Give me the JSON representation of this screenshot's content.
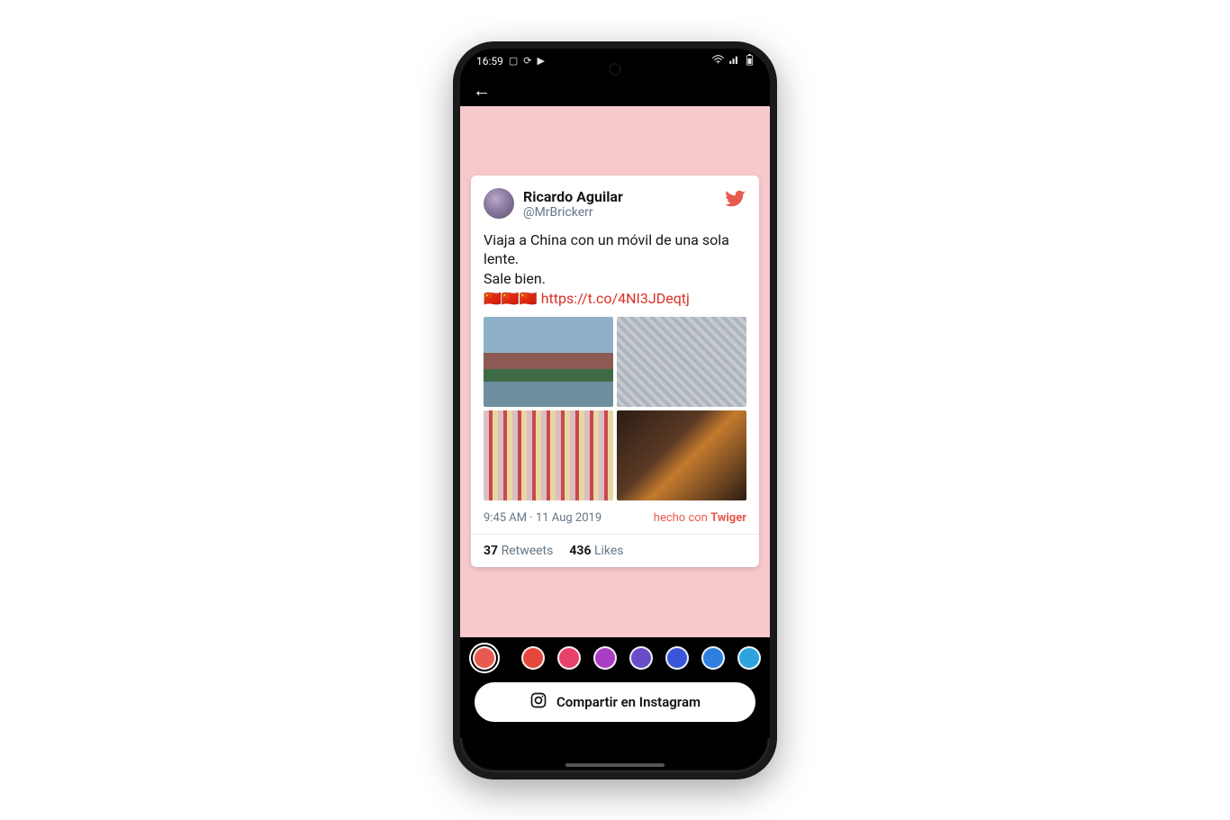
{
  "statusbar": {
    "time": "16:59",
    "left_icons": [
      "image-icon",
      "refresh-icon",
      "video-icon"
    ],
    "right_icons": [
      "wifi-icon",
      "signal-icon",
      "battery-icon"
    ]
  },
  "canvas": {
    "background_color": "#f7c9cd"
  },
  "tweet": {
    "display_name": "Ricardo Aguilar",
    "handle": "@MrBrickerr",
    "text_line1": "Viaja a China con un móvil de una sola lente.",
    "text_line2": "Sale bien.",
    "flags": "🇨🇳🇨🇳🇨🇳",
    "link": "https://t.co/4NI3JDeqtj",
    "timestamp": "9:45 AM · 11 Aug 2019",
    "credit_prefix": "hecho con ",
    "credit_app": "Twiger",
    "retweets_count": "37",
    "retweets_label": "Retweets",
    "likes_count": "436",
    "likes_label": "Likes"
  },
  "palette": {
    "selected_index": 0,
    "colors": [
      "#e85a4f",
      "#e4483d",
      "#e8416b",
      "#a93ec2",
      "#6a4cc9",
      "#3a56d8",
      "#2f7fe0",
      "#2fa3e0"
    ]
  },
  "share": {
    "label": "Compartir en Instagram"
  }
}
